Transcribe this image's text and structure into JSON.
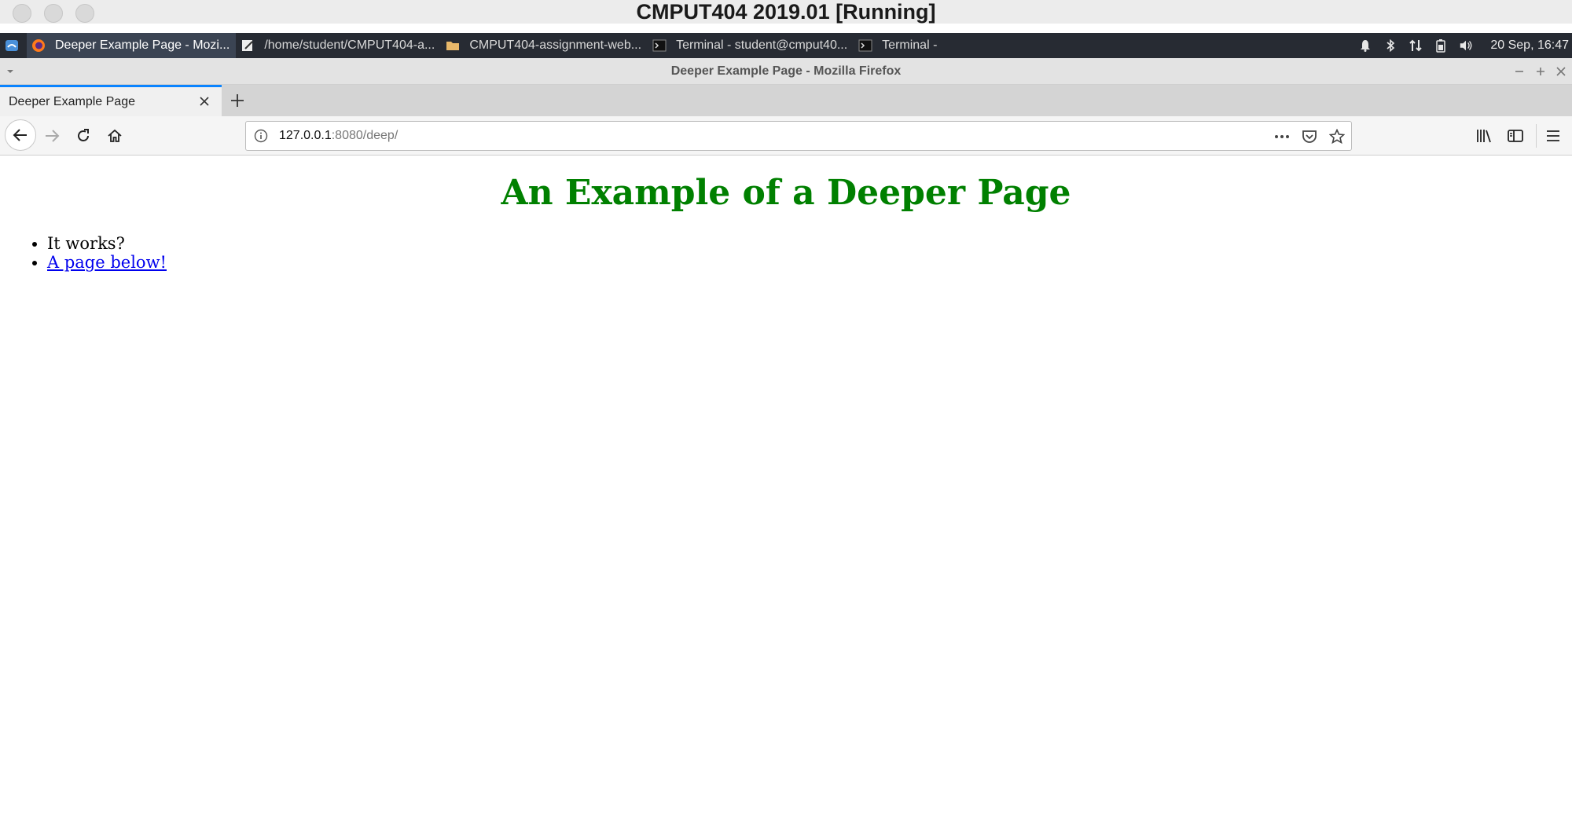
{
  "mac_window": {
    "title": "CMPUT404 2019.01 [Running]"
  },
  "panel": {
    "tasks": [
      {
        "label": "Deeper Example Page - Mozi...",
        "icon": "firefox-icon",
        "active": true
      },
      {
        "label": "/home/student/CMPUT404-a...",
        "icon": "text-editor-icon",
        "active": false
      },
      {
        "label": "CMPUT404-assignment-web...",
        "icon": "folder-icon",
        "active": false
      },
      {
        "label": "Terminal - student@cmput40...",
        "icon": "terminal-icon",
        "active": false
      },
      {
        "label": "Terminal -",
        "icon": "terminal-icon",
        "active": false
      }
    ],
    "tray_icons": [
      "bell-icon",
      "bluetooth-icon",
      "network-icon",
      "battery-icon",
      "volume-icon"
    ],
    "clock": "20 Sep, 16:47"
  },
  "firefox": {
    "window_title": "Deeper Example Page - Mozilla Firefox",
    "tab": {
      "label": "Deeper Example Page"
    },
    "url": {
      "host": "127.0.0.1",
      "rest": ":8080/deep/"
    }
  },
  "page": {
    "heading": "An Example of a Deeper Page",
    "items": [
      {
        "text": "It works?"
      },
      {
        "text": "A page below!"
      }
    ],
    "colors": {
      "heading": "#008000",
      "link": "#0000ee"
    }
  }
}
